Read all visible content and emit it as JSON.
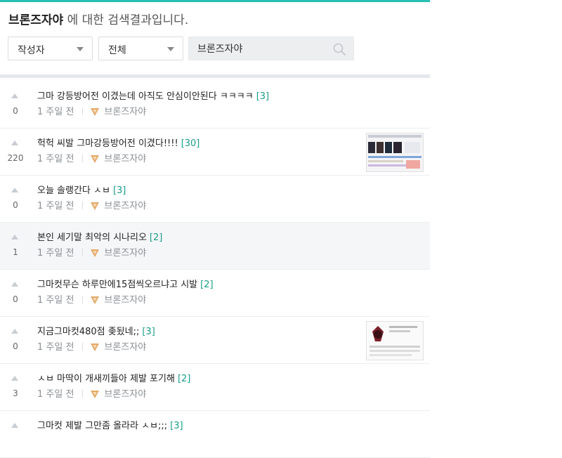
{
  "header": {
    "keyword": "브론즈자야",
    "suffix": " 에 대한 검색결과입니다."
  },
  "filters": {
    "type_selected": "작성자",
    "scope_selected": "전체"
  },
  "search": {
    "value": "브론즈자야",
    "icon": "search-icon"
  },
  "colors": {
    "accent": "#26c0b3",
    "comment_count": "#1a9e88",
    "bronze_tier": "#d9a05b"
  },
  "posts": [
    {
      "votes": "0",
      "title": "그마 강등방어전 이겼는데 아직도 안심이안된다 ㅋㅋㅋㅋ",
      "comments": "[3]",
      "time": "1 주일 전",
      "author": "브론즈자야",
      "thumbnail": false
    },
    {
      "votes": "220",
      "title": "헉헉 씨발 그마강등방어전 이겼다!!!!",
      "comments": "[30]",
      "time": "1 주일 전",
      "author": "브론즈자야",
      "thumbnail": true
    },
    {
      "votes": "0",
      "title": "오늘 솔랭간다 ㅅㅂ",
      "comments": "[3]",
      "time": "1 주일 전",
      "author": "브론즈자야",
      "thumbnail": false
    },
    {
      "votes": "1",
      "title": "본인 세기말 최악의 시나리오",
      "comments": "[2]",
      "time": "1 주일 전",
      "author": "브론즈자야",
      "thumbnail": false
    },
    {
      "votes": "0",
      "title": "그마컷무슨 하루만에15점씩오르냐고 시발",
      "comments": "[2]",
      "time": "1 주일 전",
      "author": "브론즈자야",
      "thumbnail": false
    },
    {
      "votes": "0",
      "title": "지금그마컷480점 좆됬네;;",
      "comments": "[3]",
      "time": "1 주일 전",
      "author": "브론즈자야",
      "thumbnail": true
    },
    {
      "votes": "3",
      "title": "ㅅㅂ 마딱이 개새끼들아 제발 포기해",
      "comments": "[2]",
      "time": "1 주일 전",
      "author": "브론즈자야",
      "thumbnail": false
    },
    {
      "votes": "",
      "title": "그마컷 제발 그만좀 올라라 ㅅㅂ;;;",
      "comments": "[3]",
      "time": "",
      "author": "",
      "thumbnail": false
    }
  ]
}
